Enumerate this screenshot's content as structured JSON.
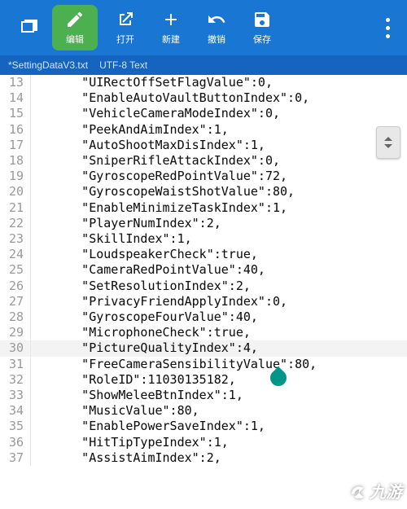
{
  "toolbar": {
    "edit": "编辑",
    "open": "打开",
    "new": "新建",
    "undo": "撤销",
    "save": "保存"
  },
  "status": {
    "filename": "*SettingDataV3.txt",
    "encoding": "UTF-8  Text"
  },
  "first_line": 13,
  "highlight_line": 30,
  "lines": [
    "\"UIRectOffSetFlagValue\":0,",
    "\"EnableAutoVaultButtonIndex\":0,",
    "\"VehicleCameraModeIndex\":0,",
    "\"PeekAndAimIndex\":1,",
    "\"AutoShootMaxDisIndex\":1,",
    "\"SniperRifleAttackIndex\":0,",
    "\"GyroscopeRedPointValue\":72,",
    "\"GyroscopeWaistShotValue\":80,",
    "\"EnableMinimizeTaskIndex\":1,",
    "\"PlayerNumIndex\":2,",
    "\"SkillIndex\":1,",
    "\"LoudspeakerCheck\":true,",
    "\"CameraRedPointValue\":40,",
    "\"SetResolutionIndex\":2,",
    "\"PrivacyFriendApplyIndex\":0,",
    "\"GyroscopeFourValue\":40,",
    "\"MicrophoneCheck\":true,",
    "\"PictureQualityIndex\":4,",
    "\"FreeCameraSensibilityValue\":80,",
    "\"RoleID\":11030135182,",
    "\"ShowMeleeBtnIndex\":1,",
    "\"MusicValue\":80,",
    "\"EnablePowerSaveIndex\":1,",
    "\"HitTipTypeIndex\":1,",
    "\"AssistAimIndex\":2,"
  ],
  "indent": "      ",
  "watermark": "九游"
}
